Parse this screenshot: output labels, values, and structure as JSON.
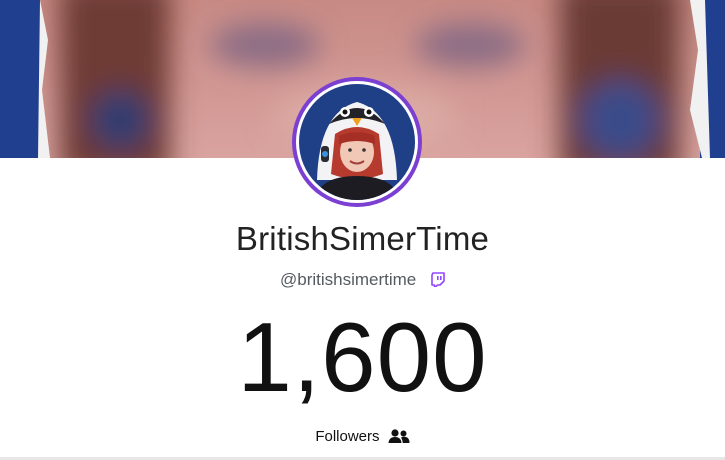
{
  "profile": {
    "display_name": "BritishSimerTime",
    "handle": "@britishsimertime",
    "platform_icon": "twitch-icon"
  },
  "stats": {
    "count": "1,600",
    "label": "Followers",
    "label_icon": "users-icon"
  },
  "colors": {
    "accent": "#7b3fd2",
    "twitch": "#9146ff",
    "text": "#222222"
  }
}
